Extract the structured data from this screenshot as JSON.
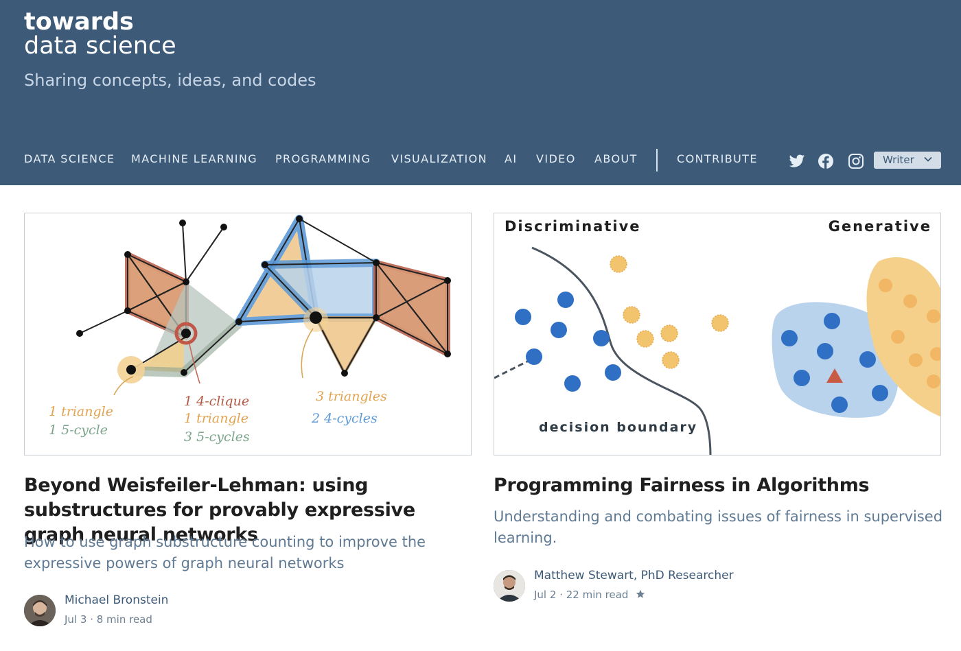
{
  "brand": {
    "name_bold": "towards",
    "name_light": "data science",
    "tagline": "Sharing concepts, ideas, and codes"
  },
  "nav": {
    "items": [
      "DATA SCIENCE",
      "MACHINE LEARNING",
      "PROGRAMMING",
      "VISUALIZATION",
      "AI",
      "VIDEO",
      "ABOUT"
    ],
    "contribute": "CONTRIBUTE",
    "writer_label": "Writer",
    "social_icons": [
      "twitter-icon",
      "facebook-icon",
      "instagram-icon"
    ]
  },
  "colors": {
    "header_bg": "#3d5a78",
    "nav_text": "#e6eef6",
    "title": "#1f1f1f",
    "subtitle": "#5f7a94",
    "author": "#3d5a78"
  },
  "articles": [
    {
      "title": "Beyond Weisfeiler-Lehman: using substructures for provably expressive graph neural networks",
      "subtitle": "How to use graph substructure counting to improve the expressive powers of graph neural networks",
      "author": "Michael Bronstein",
      "date": "Jul 3",
      "read_time": "8 min read",
      "starred": false,
      "image": {
        "annotations": [
          [
            "1 triangle",
            "1 5-cycle"
          ],
          [
            "1 4-clique",
            "1 triangle",
            "3 5-cycles"
          ],
          [
            "3 triangles",
            "2 4-cycles"
          ]
        ]
      }
    },
    {
      "title": "Programming Fairness in Algorithms",
      "subtitle": "Understanding and combating issues of fairness in supervised learning.",
      "author": "Matthew Stewart, PhD Researcher",
      "date": "Jul 2",
      "read_time": "22 min read",
      "starred": true,
      "image": {
        "label_left": "Discriminative",
        "label_right": "Generative",
        "label_boundary": "decision boundary"
      }
    }
  ]
}
